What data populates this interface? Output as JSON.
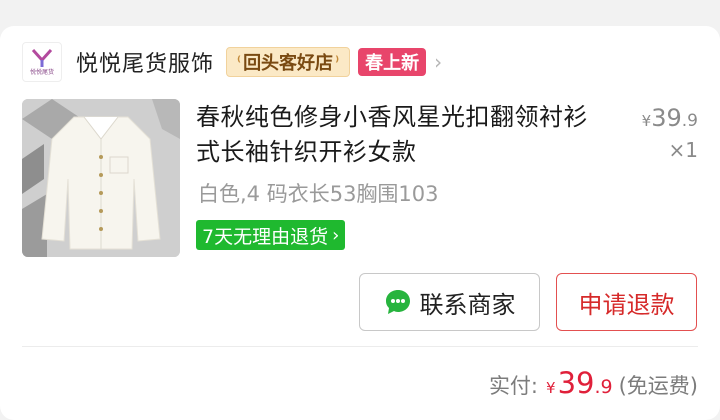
{
  "shop": {
    "logo_text": "悦悦尾货",
    "name": "悦悦尾货服饰",
    "badge_repeat": "回头客好店",
    "badge_new": "春上新"
  },
  "item": {
    "title": "春秋纯色修身小香风星光扣翻领衬衫式长袖针织开衫女款",
    "price_currency": "¥",
    "price_int": "39",
    "price_dec": ".9",
    "quantity": "×1",
    "spec": "白色,4 码衣长53胸围103",
    "return_tag": "7天无理由退货",
    "return_tag_arrow": "›"
  },
  "actions": {
    "contact_label": "联系商家",
    "refund_label": "申请退款"
  },
  "total": {
    "label": "实付:",
    "currency": "¥",
    "amount_int": "39",
    "amount_dec": ".9",
    "note": "(免运费)"
  },
  "colors": {
    "accent_red": "#e0203a",
    "return_green": "#1fb92f",
    "new_badge": "#e8456b"
  }
}
